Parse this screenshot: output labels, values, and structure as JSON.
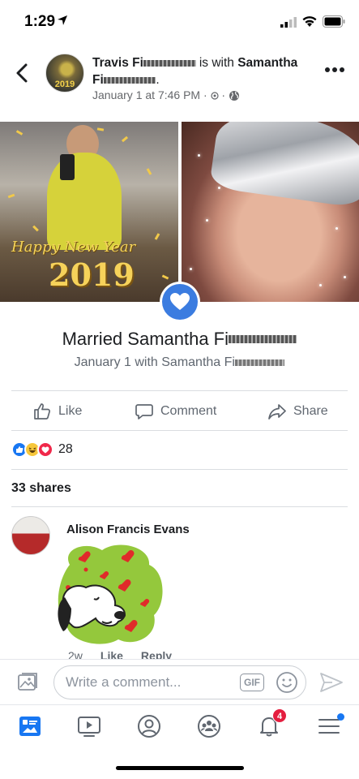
{
  "status_bar": {
    "time": "1:29"
  },
  "post": {
    "author": "Travis Fi",
    "author_redacted_suffix": "eldgrove",
    "with_text": "is with",
    "tagged_first": "Samantha",
    "tagged_last": "Fi",
    "tagged_last_redacted_suffix": "eldgrove",
    "tagged_last_end": ".",
    "date": "January 1 at 7:46 PM",
    "avatar_year": "2019",
    "photo_left_greeting": "Happy New Year",
    "photo_left_year": "2019"
  },
  "life_event": {
    "title": "Married Samantha Fi",
    "title_redacted_suffix": "eldgrove",
    "subtitle": "January 1 with Samantha Fi",
    "subtitle_redacted_suffix": "eldgrove"
  },
  "actions": {
    "like": "Like",
    "comment": "Comment",
    "share": "Share"
  },
  "reactions": {
    "count": "28",
    "types": [
      "like-icon",
      "haha-icon",
      "love-icon"
    ]
  },
  "shares": "33 shares",
  "comment": {
    "author": "Alison Francis Evans",
    "time": "2w",
    "like": "Like",
    "reply": "Reply"
  },
  "compose": {
    "placeholder": "Write a comment...",
    "gif_label": "GIF"
  },
  "tab_bar": {
    "items": [
      "news-feed-icon",
      "watch-icon",
      "profile-icon",
      "groups-icon",
      "notifications-icon",
      "menu-icon"
    ],
    "notification_count": "4"
  },
  "colors": {
    "accent": "#1877f2",
    "text_secondary": "#606770",
    "badge_red": "#e41e3f",
    "event_blue": "#3b7ce0"
  }
}
